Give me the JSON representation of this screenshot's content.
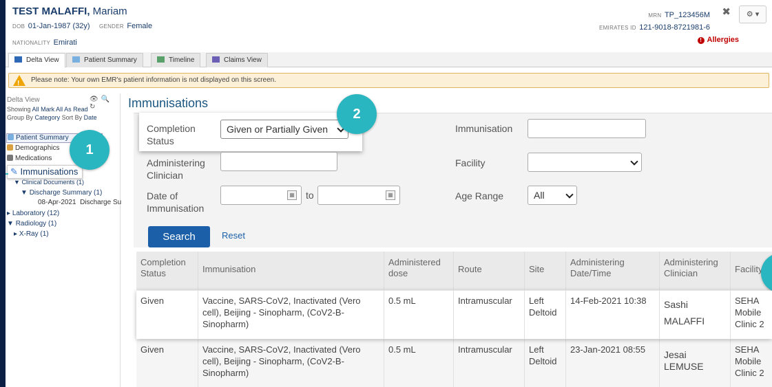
{
  "patient": {
    "last_name": "TEST MALAFFI,",
    "first_name": "Mariam",
    "dob_label": "DOB",
    "dob": "01-Jan-1987 (32y)",
    "gender_label": "GENDER",
    "gender": "Female",
    "nationality_label": "NATIONALITY",
    "nationality": "Emirati",
    "mrn_label": "MRN",
    "mrn": "TP_123456M",
    "eid_label": "EMIRATES ID",
    "eid": "121-9018-8721981-6",
    "allergies": "Allergies"
  },
  "tabs": [
    {
      "label": "Delta View",
      "icon": "delta-view-icon"
    },
    {
      "label": "Patient Summary",
      "icon": "patient-summary-icon"
    },
    {
      "label": "Timeline",
      "icon": "timeline-icon"
    },
    {
      "label": "Claims View",
      "icon": "claims-icon"
    }
  ],
  "notice": "Please note: Your own EMR's patient information is not displayed on this screen.",
  "sidebar": {
    "title": "Delta View",
    "showing_label": "Showing",
    "showing_all": "All",
    "mark_all": "Mark All As Read",
    "group_by_label": "Group By",
    "group_by": "Category",
    "sort_by_label": "Sort By",
    "sort_by": "Date",
    "items": {
      "patient_summary": "Patient Summary",
      "demographics": "Demographics",
      "medications": "Medications",
      "immunisations": "Immunisations",
      "clinical_documents": "Clinical Documents (1)",
      "discharge_summary": "Discharge Summary (1)",
      "discharge_entry_date": "08-Apr-2021",
      "discharge_entry_text": "Discharge Su",
      "laboratory": "Laboratory (12)",
      "radiology": "Radiology (1)",
      "xray": "X-Ray (1)"
    }
  },
  "main": {
    "title": "Immunisations",
    "filters": {
      "completion_status_label": "Completion Status",
      "completion_status_value": "Given or Partially Given",
      "immunisation_label": "Immunisation",
      "administering_clinician_label": "Administering Clinician",
      "facility_label": "Facility",
      "date_label": "Date of Immunisation",
      "to_label": "to",
      "age_range_label": "Age Range",
      "age_range_value": "All"
    },
    "search_label": "Search",
    "reset_label": "Reset",
    "table": {
      "headers": [
        "Completion Status",
        "Immunisation",
        "Administered dose",
        "Route",
        "Site",
        "Administering Date/Time",
        "Administering Clinician",
        "Facility"
      ],
      "rows": [
        [
          "Given",
          "Vaccine, SARS-CoV2, Inactivated (Vero cell), Beijing - Sinopharm, (CoV2-B-Sinopharm)",
          "0.5 mL",
          "Intramuscular",
          "Left Deltoid",
          "14-Feb-2021 10:38",
          "Sashi MALAFFI",
          "SEHA Mobile Clinic 2"
        ],
        [
          "Given",
          "Vaccine, SARS-CoV2, Inactivated (Vero cell), Beijing - Sinopharm, (CoV2-B-Sinopharm)",
          "0.5 mL",
          "Intramuscular",
          "Left Deltoid",
          "23-Jan-2021 08:55",
          "Jesai LEMUSE",
          "SEHA Mobile Clinic 2"
        ]
      ]
    }
  },
  "callouts": [
    "1",
    "2"
  ],
  "colors": {
    "accent": "#2ab6c0",
    "primary": "#1a5fa8",
    "alert": "#c00000"
  }
}
